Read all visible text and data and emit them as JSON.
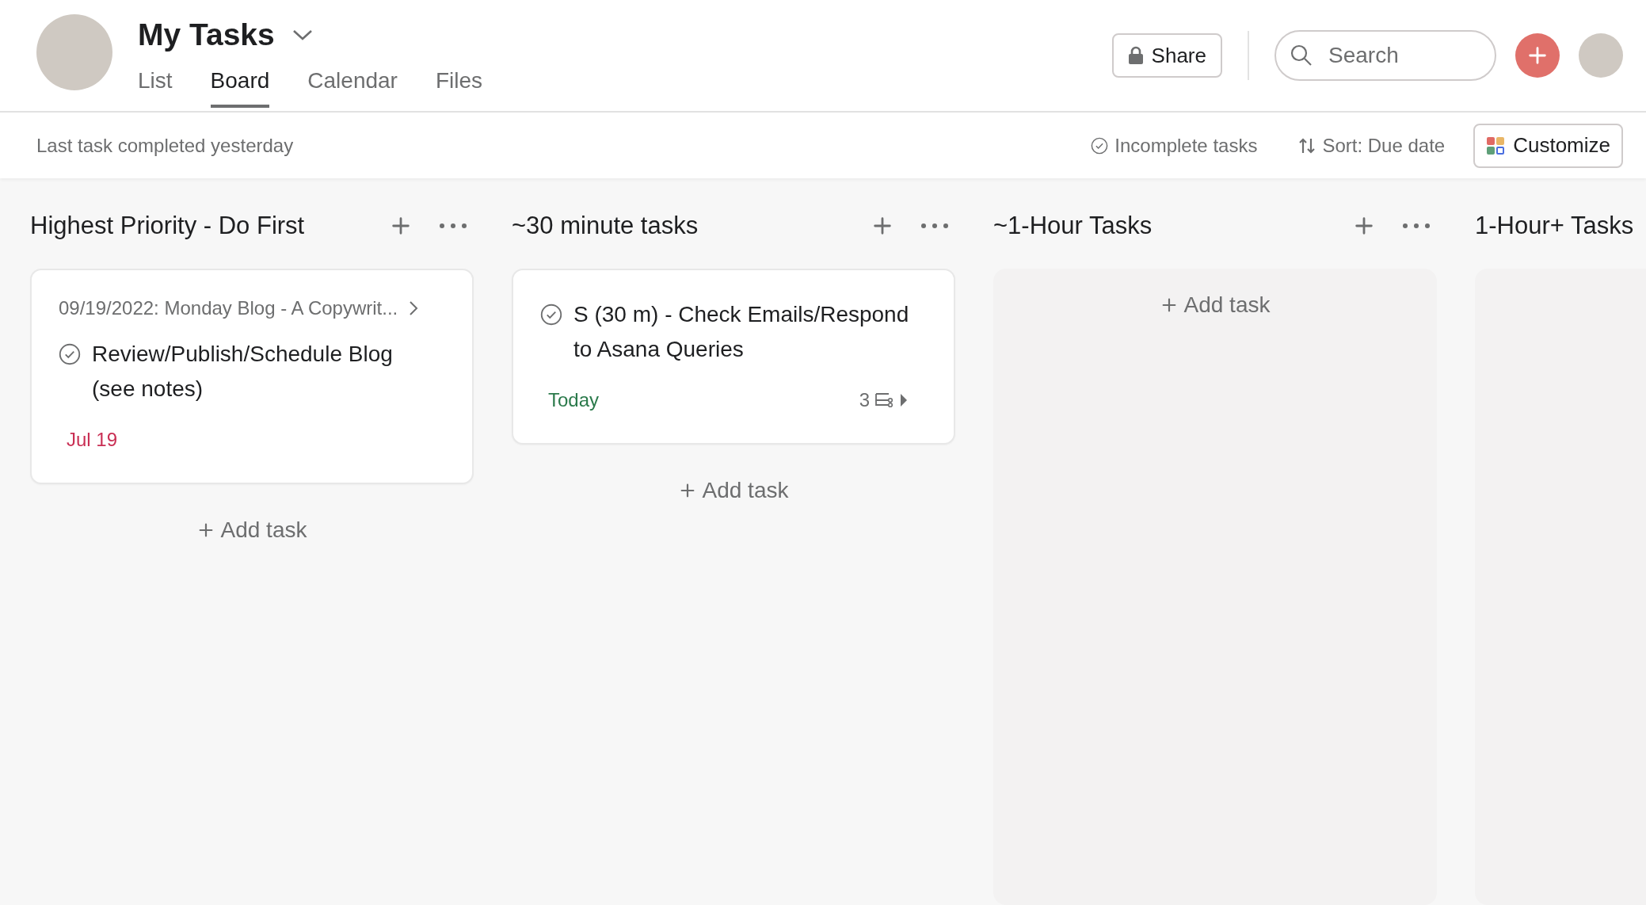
{
  "header": {
    "title": "My Tasks",
    "tabs": [
      {
        "label": "List",
        "selected": false
      },
      {
        "label": "Board",
        "selected": true
      },
      {
        "label": "Calendar",
        "selected": false
      },
      {
        "label": "Files",
        "selected": false
      }
    ],
    "share": "Share",
    "search": {
      "placeholder": "Search"
    }
  },
  "toolbar": {
    "status": "Last task completed yesterday",
    "filter": "Incomplete tasks",
    "sort": "Sort: Due date",
    "customize": "Customize"
  },
  "columns": [
    {
      "title": "Highest Priority - Do First",
      "actions_visible": true,
      "kind": "cards",
      "add_task": "Add task",
      "tasks": [
        {
          "project": "09/19/2022: Monday Blog - A Copywrit...",
          "name": "Review/Publish/Schedule Blog (see notes)",
          "due": "Jul 19",
          "color": "#c92f54"
        }
      ]
    },
    {
      "title": "~30 minute tasks",
      "actions_visible": true,
      "kind": "cards",
      "add_task": "Add task",
      "tasks": [
        {
          "name": "S (30 m) - Check Emails/Respond to Asana Queries",
          "due": "Today",
          "color": "#2b7a4b",
          "subtasks": "3"
        }
      ]
    },
    {
      "title": "~1-Hour Tasks",
      "actions_visible": true,
      "kind": "empty",
      "add_task": "Add task"
    },
    {
      "title": "1-Hour+ Tasks",
      "kind": "empty"
    }
  ]
}
